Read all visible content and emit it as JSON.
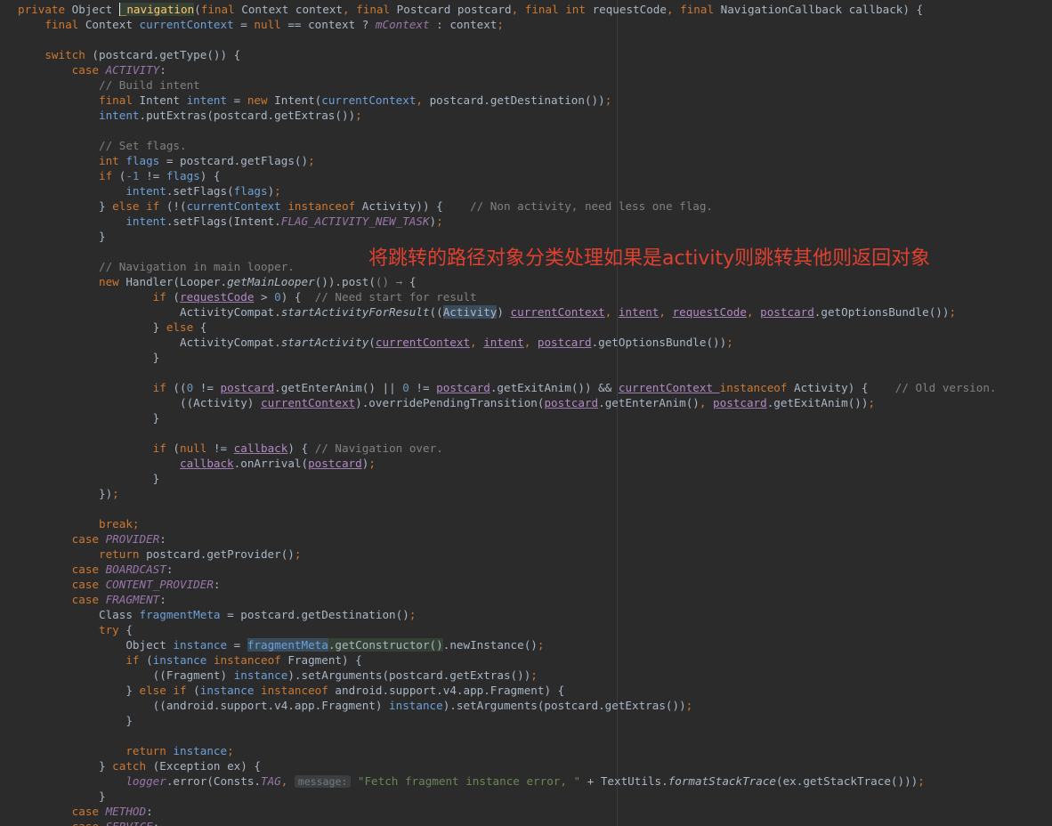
{
  "annotation": "将跳转的路径对象分类处理如果是activity则跳转其他则返回对象",
  "colors": {
    "background": "#2b2b2b",
    "keyword": "#cc7832",
    "field": "#9876aa",
    "comment": "#808080",
    "number": "#6897bb",
    "string": "#6a8759",
    "method_declaration": "#ffc66d",
    "annotation_text": "#e0402f"
  },
  "lines": [
    [
      {
        "t": "private ",
        "c": "kw"
      },
      {
        "t": "Object "
      },
      {
        "caret": true
      },
      {
        "t": "_navigation",
        "c": "fn hl-ident"
      },
      {
        "t": "("
      },
      {
        "t": "final ",
        "c": "kw"
      },
      {
        "t": "Context context"
      },
      {
        "t": ", ",
        "c": "kw"
      },
      {
        "t": "final ",
        "c": "kw"
      },
      {
        "t": "Postcard postcard"
      },
      {
        "t": ", ",
        "c": "kw"
      },
      {
        "t": "final int ",
        "c": "kw"
      },
      {
        "t": "requestCode"
      },
      {
        "t": ", ",
        "c": "kw"
      },
      {
        "t": "final ",
        "c": "kw"
      },
      {
        "t": "NavigationCallback callback) {"
      }
    ],
    [
      {
        "i": 1
      },
      {
        "t": "final ",
        "c": "kw"
      },
      {
        "t": "Context "
      },
      {
        "t": "currentContext",
        "c": "lv"
      },
      {
        "t": " = "
      },
      {
        "t": "null ",
        "c": "kw"
      },
      {
        "t": "== context ? "
      },
      {
        "t": "mContext",
        "c": "stat"
      },
      {
        "t": " : context"
      },
      {
        "t": ";",
        "c": "kw"
      }
    ],
    [],
    [
      {
        "i": 1
      },
      {
        "t": "switch ",
        "c": "kw"
      },
      {
        "t": "(postcard.getType()) {"
      }
    ],
    [
      {
        "i": 2
      },
      {
        "t": "case ",
        "c": "kw"
      },
      {
        "t": "ACTIVITY",
        "c": "stat"
      },
      {
        "t": ":"
      }
    ],
    [
      {
        "i": 3
      },
      {
        "t": "// Build intent",
        "c": "cm"
      }
    ],
    [
      {
        "i": 3
      },
      {
        "t": "final ",
        "c": "kw"
      },
      {
        "t": "Intent "
      },
      {
        "t": "intent",
        "c": "lv"
      },
      {
        "t": " = "
      },
      {
        "t": "new ",
        "c": "kw"
      },
      {
        "t": "Intent("
      },
      {
        "t": "currentContext",
        "c": "lv"
      },
      {
        "t": ", ",
        "c": "kw"
      },
      {
        "t": "postcard.getDestination())"
      },
      {
        "t": ";",
        "c": "kw"
      }
    ],
    [
      {
        "i": 3
      },
      {
        "t": "intent",
        "c": "lv"
      },
      {
        "t": ".putExtras(postcard.getExtras())"
      },
      {
        "t": ";",
        "c": "kw"
      }
    ],
    [],
    [
      {
        "i": 3
      },
      {
        "t": "// Set flags.",
        "c": "cm"
      }
    ],
    [
      {
        "i": 3
      },
      {
        "t": "int ",
        "c": "kw"
      },
      {
        "t": "flags",
        "c": "lv"
      },
      {
        "t": " = postcard.getFlags()"
      },
      {
        "t": ";",
        "c": "kw"
      }
    ],
    [
      {
        "i": 3
      },
      {
        "t": "if ",
        "c": "kw"
      },
      {
        "t": "("
      },
      {
        "t": "-1 ",
        "c": "num"
      },
      {
        "t": "!= "
      },
      {
        "t": "flags",
        "c": "lv"
      },
      {
        "t": ") {"
      }
    ],
    [
      {
        "i": 4
      },
      {
        "t": "intent",
        "c": "lv"
      },
      {
        "t": ".setFlags("
      },
      {
        "t": "flags",
        "c": "lv"
      },
      {
        "t": ")"
      },
      {
        "t": ";",
        "c": "kw"
      }
    ],
    [
      {
        "i": 3
      },
      {
        "t": "} "
      },
      {
        "t": "else if ",
        "c": "kw"
      },
      {
        "t": "(!("
      },
      {
        "t": "currentContext ",
        "c": "lv"
      },
      {
        "t": "instanceof ",
        "c": "kw"
      },
      {
        "t": "Activity)) {    "
      },
      {
        "t": "// Non activity, need less one flag.",
        "c": "cm"
      }
    ],
    [
      {
        "i": 4
      },
      {
        "t": "intent",
        "c": "lv"
      },
      {
        "t": ".setFlags(Intent."
      },
      {
        "t": "FLAG_ACTIVITY_NEW_TASK",
        "c": "stat"
      },
      {
        "t": ")"
      },
      {
        "t": ";",
        "c": "kw"
      }
    ],
    [
      {
        "i": 3
      },
      {
        "t": "}"
      }
    ],
    [],
    [
      {
        "i": 3
      },
      {
        "t": "// Navigation in main looper.",
        "c": "cm"
      }
    ],
    [
      {
        "i": 3
      },
      {
        "t": "new ",
        "c": "kw"
      },
      {
        "t": "Handler(Looper."
      },
      {
        "t": "getMainLooper",
        "c": "it"
      },
      {
        "t": "()).post("
      },
      {
        "t": "() ",
        "c": "lambda-arrow"
      },
      {
        "t": "→ ",
        "c": "lambda-arrow"
      },
      {
        "t": "{"
      }
    ],
    [
      {
        "i": 5
      },
      {
        "t": "if ",
        "c": "kw"
      },
      {
        "t": "("
      },
      {
        "t": "requestCode",
        "c": "cap"
      },
      {
        "t": " > "
      },
      {
        "t": "0",
        "c": "num"
      },
      {
        "t": ") {  "
      },
      {
        "t": "// Need start for result",
        "c": "cm"
      }
    ],
    [
      {
        "i": 6
      },
      {
        "t": "ActivityCompat."
      },
      {
        "t": "startActivityForResult",
        "c": "it"
      },
      {
        "t": "(("
      },
      {
        "t": "Activity",
        "c": "hl-use"
      },
      {
        "t": ") "
      },
      {
        "t": "currentContext",
        "c": "cap"
      },
      {
        "t": ", ",
        "c": "kw"
      },
      {
        "t": "intent",
        "c": "cap"
      },
      {
        "t": ", ",
        "c": "kw"
      },
      {
        "t": "requestCode",
        "c": "cap"
      },
      {
        "t": ", ",
        "c": "kw"
      },
      {
        "t": "postcard",
        "c": "cap"
      },
      {
        "t": ".getOptionsBundle())"
      },
      {
        "t": ";",
        "c": "kw"
      }
    ],
    [
      {
        "i": 5
      },
      {
        "t": "} "
      },
      {
        "t": "else ",
        "c": "kw"
      },
      {
        "t": "{"
      }
    ],
    [
      {
        "i": 6
      },
      {
        "t": "ActivityCompat."
      },
      {
        "t": "startActivity",
        "c": "it"
      },
      {
        "t": "("
      },
      {
        "t": "currentContext",
        "c": "cap"
      },
      {
        "t": ", ",
        "c": "kw"
      },
      {
        "t": "intent",
        "c": "cap"
      },
      {
        "t": ", ",
        "c": "kw"
      },
      {
        "t": "postcard",
        "c": "cap"
      },
      {
        "t": ".getOptionsBundle())"
      },
      {
        "t": ";",
        "c": "kw"
      }
    ],
    [
      {
        "i": 5
      },
      {
        "t": "}"
      }
    ],
    [],
    [
      {
        "i": 5
      },
      {
        "t": "if ",
        "c": "kw"
      },
      {
        "t": "(("
      },
      {
        "t": "0 ",
        "c": "num"
      },
      {
        "t": "!= "
      },
      {
        "t": "postcard",
        "c": "cap"
      },
      {
        "t": ".getEnterAnim() || "
      },
      {
        "t": "0 ",
        "c": "num"
      },
      {
        "t": "!= "
      },
      {
        "t": "postcard",
        "c": "cap"
      },
      {
        "t": ".getExitAnim()) && "
      },
      {
        "t": "currentContext ",
        "c": "cap"
      },
      {
        "t": "instanceof ",
        "c": "kw"
      },
      {
        "t": "Activity) {    "
      },
      {
        "t": "// Old version.",
        "c": "cm"
      }
    ],
    [
      {
        "i": 6
      },
      {
        "t": "((Activity) "
      },
      {
        "t": "currentContext",
        "c": "cap"
      },
      {
        "t": ").overridePendingTransition("
      },
      {
        "t": "postcard",
        "c": "cap"
      },
      {
        "t": ".getEnterAnim()"
      },
      {
        "t": ", ",
        "c": "kw"
      },
      {
        "t": "postcard",
        "c": "cap"
      },
      {
        "t": ".getExitAnim())"
      },
      {
        "t": ";",
        "c": "kw"
      }
    ],
    [
      {
        "i": 5
      },
      {
        "t": "}"
      }
    ],
    [],
    [
      {
        "i": 5
      },
      {
        "t": "if ",
        "c": "kw"
      },
      {
        "t": "("
      },
      {
        "t": "null ",
        "c": "kw"
      },
      {
        "t": "!= "
      },
      {
        "t": "callback",
        "c": "cap"
      },
      {
        "t": ") { "
      },
      {
        "t": "// Navigation over.",
        "c": "cm"
      }
    ],
    [
      {
        "i": 6
      },
      {
        "t": "callback",
        "c": "cap"
      },
      {
        "t": ".onArrival("
      },
      {
        "t": "postcard",
        "c": "cap"
      },
      {
        "t": ")"
      },
      {
        "t": ";",
        "c": "kw"
      }
    ],
    [
      {
        "i": 5
      },
      {
        "t": "}"
      }
    ],
    [
      {
        "i": 3
      },
      {
        "t": "})"
      },
      {
        "t": ";",
        "c": "kw"
      }
    ],
    [],
    [
      {
        "i": 3
      },
      {
        "t": "break;",
        "c": "kw"
      }
    ],
    [
      {
        "i": 2
      },
      {
        "t": "case ",
        "c": "kw"
      },
      {
        "t": "PROVIDER",
        "c": "stat"
      },
      {
        "t": ":"
      }
    ],
    [
      {
        "i": 3
      },
      {
        "t": "return ",
        "c": "kw"
      },
      {
        "t": "postcard.getProvider()"
      },
      {
        "t": ";",
        "c": "kw"
      }
    ],
    [
      {
        "i": 2
      },
      {
        "t": "case ",
        "c": "kw"
      },
      {
        "t": "BOARDCAST",
        "c": "stat"
      },
      {
        "t": ":"
      }
    ],
    [
      {
        "i": 2
      },
      {
        "t": "case ",
        "c": "kw"
      },
      {
        "t": "CONTENT_PROVIDER",
        "c": "stat"
      },
      {
        "t": ":"
      }
    ],
    [
      {
        "i": 2
      },
      {
        "t": "case ",
        "c": "kw"
      },
      {
        "t": "FRAGMENT",
        "c": "stat"
      },
      {
        "t": ":"
      }
    ],
    [
      {
        "i": 3
      },
      {
        "t": "Class "
      },
      {
        "t": "fragmentMeta",
        "c": "lv"
      },
      {
        "t": " = postcard.getDestination()"
      },
      {
        "t": ";",
        "c": "kw"
      }
    ],
    [
      {
        "i": 3
      },
      {
        "t": "try ",
        "c": "kw"
      },
      {
        "t": "{"
      }
    ],
    [
      {
        "i": 4
      },
      {
        "t": "Object "
      },
      {
        "t": "instance",
        "c": "lv"
      },
      {
        "t": " = "
      },
      {
        "t": "fragmentMeta",
        "c": "lv hl-use"
      },
      {
        "t": ".getConstructor()",
        "c": "hl-ident"
      },
      {
        "t": ".newInstance()"
      },
      {
        "t": ";",
        "c": "kw"
      }
    ],
    [
      {
        "i": 4
      },
      {
        "t": "if ",
        "c": "kw"
      },
      {
        "t": "("
      },
      {
        "t": "instance ",
        "c": "lv"
      },
      {
        "t": "instanceof ",
        "c": "kw"
      },
      {
        "t": "Fragment) {"
      }
    ],
    [
      {
        "i": 5
      },
      {
        "t": "((Fragment) "
      },
      {
        "t": "instance",
        "c": "lv"
      },
      {
        "t": ").setArguments(postcard.getExtras())"
      },
      {
        "t": ";",
        "c": "kw"
      }
    ],
    [
      {
        "i": 4
      },
      {
        "t": "} "
      },
      {
        "t": "else if ",
        "c": "kw"
      },
      {
        "t": "("
      },
      {
        "t": "instance ",
        "c": "lv"
      },
      {
        "t": "instanceof ",
        "c": "kw"
      },
      {
        "t": "android.support.v4.app.Fragment) {"
      }
    ],
    [
      {
        "i": 5
      },
      {
        "t": "((android.support.v4.app.Fragment) "
      },
      {
        "t": "instance",
        "c": "lv"
      },
      {
        "t": ").setArguments(postcard.getExtras())"
      },
      {
        "t": ";",
        "c": "kw"
      }
    ],
    [
      {
        "i": 4
      },
      {
        "t": "}"
      }
    ],
    [],
    [
      {
        "i": 4
      },
      {
        "t": "return ",
        "c": "kw"
      },
      {
        "t": "instance",
        "c": "lv"
      },
      {
        "t": ";",
        "c": "kw"
      }
    ],
    [
      {
        "i": 3
      },
      {
        "t": "} "
      },
      {
        "t": "catch ",
        "c": "kw"
      },
      {
        "t": "(Exception ex) {"
      }
    ],
    [
      {
        "i": 4
      },
      {
        "t": "logger",
        "c": "stat"
      },
      {
        "t": ".error(Consts."
      },
      {
        "t": "TAG",
        "c": "stat"
      },
      {
        "t": ", ",
        "c": "kw"
      },
      {
        "hint": "message:"
      },
      {
        "t": " "
      },
      {
        "t": "\"Fetch fragment instance error, \" ",
        "c": "str"
      },
      {
        "t": "+ TextUtils."
      },
      {
        "t": "formatStackTrace",
        "c": "it"
      },
      {
        "t": "(ex.getStackTrace()))"
      },
      {
        "t": ";",
        "c": "kw"
      }
    ],
    [
      {
        "i": 3
      },
      {
        "t": "}"
      }
    ],
    [
      {
        "i": 2
      },
      {
        "t": "case ",
        "c": "kw"
      },
      {
        "t": "METHOD",
        "c": "stat"
      },
      {
        "t": ":"
      }
    ],
    [
      {
        "i": 2
      },
      {
        "t": "case ",
        "c": "kw"
      },
      {
        "t": "SERVICE",
        "c": "stat"
      },
      {
        "t": ":"
      }
    ]
  ]
}
